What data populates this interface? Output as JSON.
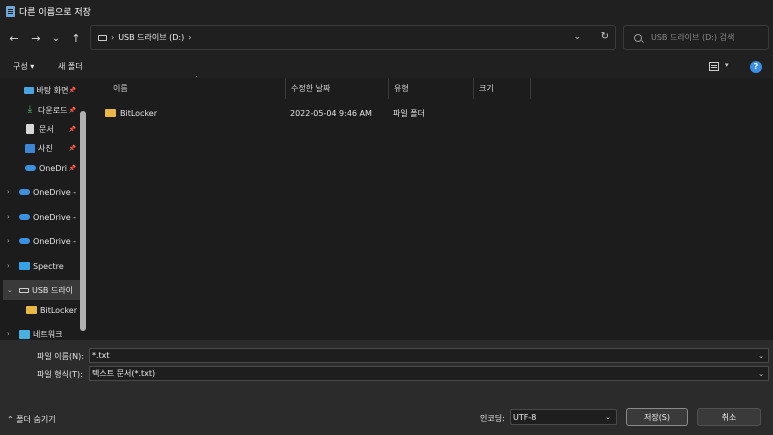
{
  "window": {
    "title": "다른 이름으로 저장"
  },
  "navigation": {
    "back_icon": "←",
    "forward_icon": "→",
    "history_icon": "⌄",
    "up_icon": "↑",
    "breadcrumb_sep": "›",
    "breadcrumb_drive": "USB 드라이브 (D:)",
    "breadcrumb_trail": "›",
    "dropdown_icon": "⌄",
    "refresh_icon": "↻",
    "search_placeholder": "USB 드라이브 (D:) 검색"
  },
  "toolbar": {
    "organize_label": "구성 ▾",
    "new_folder_label": "새 폴더",
    "view_dropdown": "▾",
    "help_label": "?"
  },
  "sidebar": {
    "pin_glyph": "📌",
    "items": [
      {
        "label": "바탕 화면",
        "icon": "desktop-icon",
        "pinned": true
      },
      {
        "label": "다운로드",
        "icon": "download-icon",
        "pinned": true
      },
      {
        "label": "문서",
        "icon": "documents-icon",
        "pinned": true
      },
      {
        "label": "사진",
        "icon": "pictures-icon",
        "pinned": true
      },
      {
        "label": "OneDri",
        "icon": "onedrive-icon",
        "pinned": true
      },
      {
        "label": "OneDrive -",
        "icon": "onedrive-icon",
        "expand": "›"
      },
      {
        "label": "OneDrive -",
        "icon": "onedrive-icon",
        "expand": "›"
      },
      {
        "label": "OneDrive -",
        "icon": "onedrive-icon",
        "expand": "›"
      },
      {
        "label": "Spectre",
        "icon": "pc-icon",
        "expand": "›"
      },
      {
        "label": "USB 드라이",
        "icon": "usb-drive-icon",
        "expand": "⌄",
        "selected": true
      },
      {
        "label": "BitLocker",
        "icon": "folder-icon"
      },
      {
        "label": "네트워크",
        "icon": "network-icon",
        "expand": "›"
      }
    ]
  },
  "file_list": {
    "sort_indicator": "˄",
    "columns": [
      "이름",
      "수정한 날짜",
      "유형",
      "크기"
    ],
    "rows": [
      {
        "name": "BitLocker",
        "modified": "2022-05-04 9:46 AM",
        "type": "파일 폴더",
        "size": ""
      }
    ]
  },
  "save_form": {
    "filename_label": "파일 이름(N):",
    "filename_value": "*.txt",
    "filetype_label": "파일 형식(T):",
    "filetype_value": "텍스트 문서(*.txt)",
    "dropdown_icon": "⌄",
    "hide_folders_label": "⌃ 폴더 숨기기",
    "encoding_label": "인코딩:",
    "encoding_value": "UTF-8",
    "save_label": "저장(S)",
    "cancel_label": "취소"
  }
}
